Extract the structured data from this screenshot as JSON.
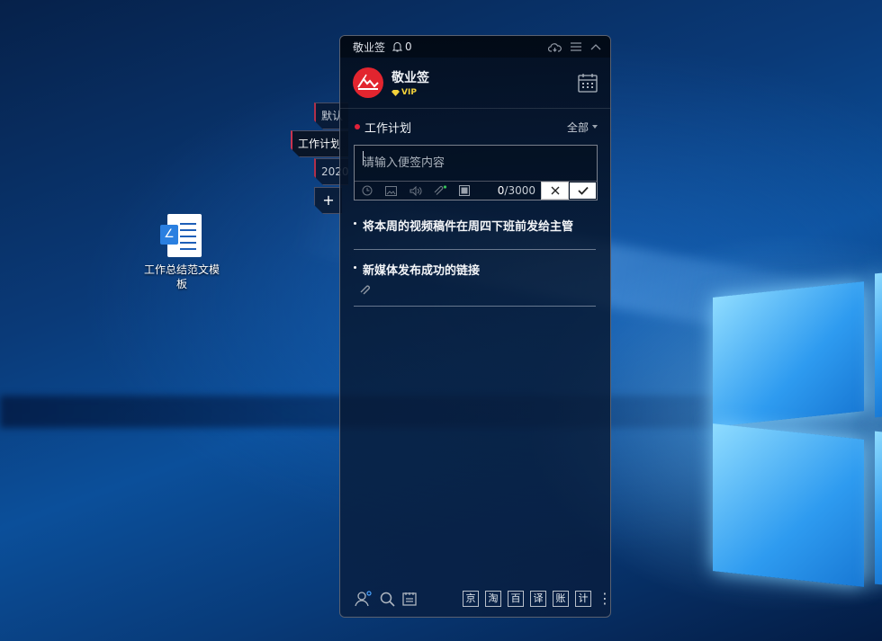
{
  "desktop": {
    "icon_label": "工作总结范文模板"
  },
  "side_tabs": [
    {
      "label": "默认"
    },
    {
      "label": "工作计划"
    },
    {
      "label": "2020"
    },
    {
      "label": "+"
    }
  ],
  "window": {
    "app_name": "敬业签",
    "notification_count": "0",
    "icons": [
      "bell-icon",
      "cloud-sync-icon",
      "menu-icon",
      "collapse-icon"
    ]
  },
  "profile": {
    "name": "敬业签",
    "vip_label": "VIP"
  },
  "category": {
    "title": "工作计划",
    "filter": "全部"
  },
  "editor": {
    "placeholder": "请输入便签内容",
    "count_current": "0",
    "count_max": "/3000"
  },
  "notes": [
    {
      "text": "将本周的视频稿件在周四下班前发给主管"
    },
    {
      "text": "新媒体发布成功的链接",
      "has_attachment": true
    }
  ],
  "bottom": {
    "shortcuts": [
      "京",
      "淘",
      "百",
      "译",
      "账",
      "计"
    ]
  },
  "colors": {
    "accent_red": "#e2252f",
    "vip_gold": "#f4d33a"
  }
}
